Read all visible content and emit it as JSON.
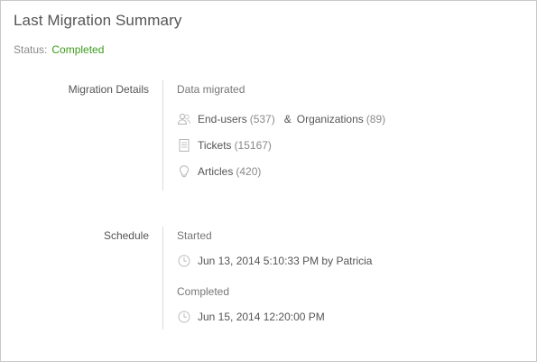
{
  "title": "Last Migration Summary",
  "status": {
    "label": "Status:",
    "value": "Completed",
    "color": "#3b9b1a"
  },
  "migration_details": {
    "label": "Migration Details",
    "heading": "Data migrated",
    "end_users": {
      "label": "End-users",
      "count": "(537)",
      "icon": "users-icon"
    },
    "connector": "&",
    "organizations": {
      "label": "Organizations",
      "count": "(89)"
    },
    "tickets": {
      "label": "Tickets",
      "count": "(15167)",
      "icon": "ticket-icon"
    },
    "articles": {
      "label": "Articles",
      "count": "(420)",
      "icon": "lightbulb-icon"
    }
  },
  "schedule": {
    "label": "Schedule",
    "started_heading": "Started",
    "started_value": "Jun 13, 2014 5:10:33 PM by Patricia",
    "completed_heading": "Completed",
    "completed_value": "Jun 15, 2014 12:20:00 PM",
    "icon": "clock-icon"
  }
}
